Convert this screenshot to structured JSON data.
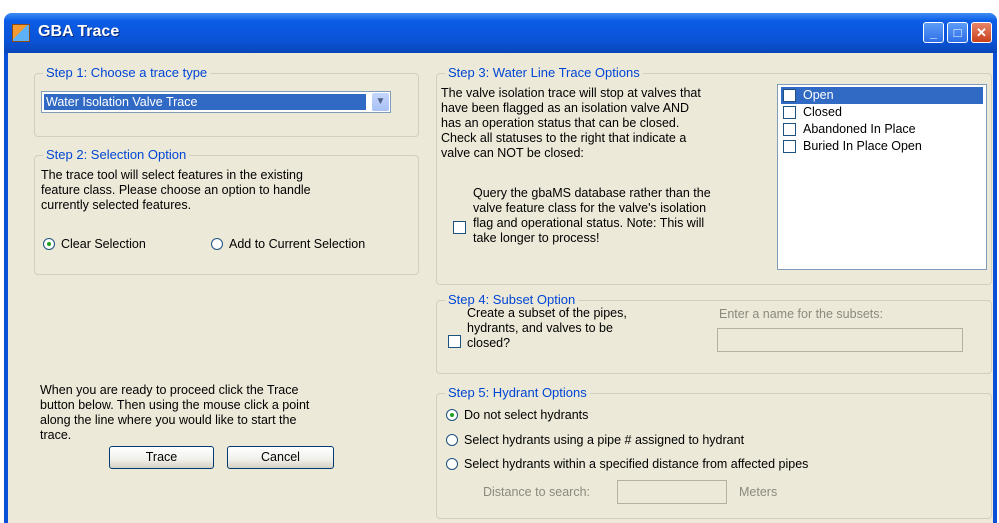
{
  "window": {
    "title": "GBA Trace",
    "controls": {
      "minimize": "_",
      "maximize": "□",
      "close": "✕"
    }
  },
  "step1": {
    "legend": "Step 1:  Choose a trace type",
    "selected": "Water Isolation Valve Trace",
    "arrow": "▼"
  },
  "step2": {
    "legend": "Step 2:  Selection Option",
    "description": [
      "The trace tool will select features in the existing",
      "feature class.  Please choose an option to handle",
      "currently selected features."
    ],
    "options": [
      {
        "label": "Clear Selection",
        "checked": true
      },
      {
        "label": "Add to Current Selection",
        "checked": false
      }
    ]
  },
  "instructions": [
    "When you are ready to proceed click the Trace",
    "button below.  Then using the mouse click a point",
    "along the line where you would like to start the",
    "trace."
  ],
  "buttons": {
    "trace": "Trace",
    "cancel": "Cancel"
  },
  "step3": {
    "legend": "Step 3:  Water Line Trace Options",
    "description": [
      "The valve isolation trace will stop at valves that",
      "have been flagged as an isolation valve AND",
      "has an operation status that can be closed.",
      "Check all statuses to the right that indicate a",
      "valve can NOT be closed:"
    ],
    "query_text": [
      "Query the gbaMS database rather than the",
      "valve feature class for the valve's isolation",
      "flag and operational status.  Note:  This will",
      "take longer to process!"
    ],
    "query_checked": false,
    "statuses": [
      {
        "label": "Open",
        "checked": false,
        "selected": true
      },
      {
        "label": "Closed",
        "checked": false,
        "selected": false
      },
      {
        "label": "Abandoned In Place",
        "checked": false,
        "selected": false
      },
      {
        "label": "Buried In Place Open",
        "checked": false,
        "selected": false
      }
    ]
  },
  "step4": {
    "legend": "Step 4:  Subset Option",
    "checkbox_text": [
      "Create a subset of the pipes,",
      "hydrants, and valves to be",
      "closed?"
    ],
    "checked": false,
    "name_label": "Enter a name for the subsets:",
    "name_value": ""
  },
  "step5": {
    "legend": "Step 5:  Hydrant Options",
    "options": [
      {
        "label": "Do not select hydrants",
        "checked": true
      },
      {
        "label": "Select hydrants using a pipe # assigned to hydrant",
        "checked": false
      },
      {
        "label": "Select hydrants within a specified distance from affected pipes",
        "checked": false
      }
    ],
    "distance_label": "Distance to search:",
    "distance_value": "",
    "distance_unit": "Meters"
  }
}
